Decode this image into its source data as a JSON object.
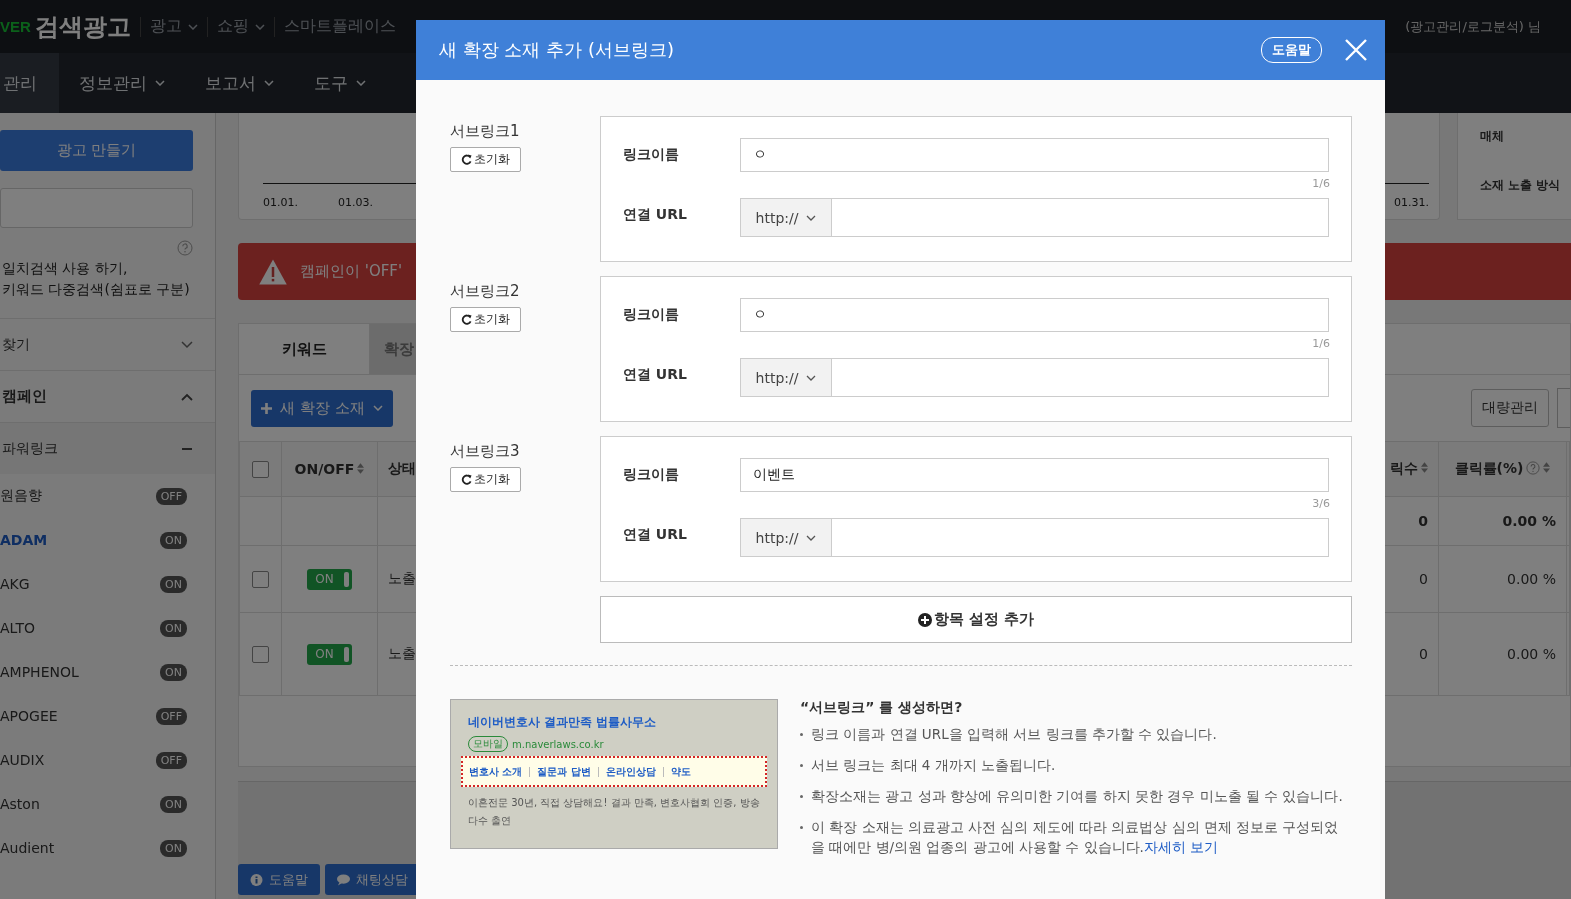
{
  "topbar": {
    "logo_mark": "VER",
    "logo": "검색광고",
    "menus": [
      {
        "label": "광고",
        "dropdown": true
      },
      {
        "label": "쇼핑",
        "dropdown": true
      },
      {
        "label": "스마트플레이스",
        "dropdown": false
      }
    ],
    "account": "(광고관리/로그분석) 님"
  },
  "nav": [
    {
      "label": "관리",
      "selected": true,
      "dropdown": false
    },
    {
      "label": "정보관리",
      "selected": false,
      "dropdown": true
    },
    {
      "label": "보고서",
      "selected": false,
      "dropdown": true
    },
    {
      "label": "도구",
      "selected": false,
      "dropdown": true
    }
  ],
  "sidebar": {
    "create_button": "광고 만들기",
    "search_hint": "일치검색 사용 하기,\n키워드 다중검색(쉼표로 구분)",
    "find": {
      "label": "찾기",
      "expanded": false
    },
    "campaigns": {
      "label": "캠페인",
      "expanded": true
    },
    "group": {
      "label": "파워링크",
      "expanded": true
    },
    "items": [
      {
        "name": "원음향",
        "status": "OFF",
        "selected": false
      },
      {
        "name": "ADAM",
        "status": "ON",
        "selected": true
      },
      {
        "name": "AKG",
        "status": "ON",
        "selected": false
      },
      {
        "name": "ALTO",
        "status": "ON",
        "selected": false
      },
      {
        "name": "AMPHENOL",
        "status": "ON",
        "selected": false
      },
      {
        "name": "APOGEE",
        "status": "OFF",
        "selected": false
      },
      {
        "name": "AUDIX",
        "status": "OFF",
        "selected": false
      },
      {
        "name": "Aston",
        "status": "ON",
        "selected": false
      },
      {
        "name": "Audient",
        "status": "ON",
        "selected": false
      }
    ]
  },
  "main": {
    "chart_ticks": [
      "01.01.",
      "01.03.",
      "01.31."
    ],
    "info_card": [
      "매체",
      "소재 노출 방식"
    ],
    "alert": "캠페인이 'OFF'",
    "tabs": [
      {
        "label": "키워드",
        "selected": true
      },
      {
        "label": "확장",
        "selected": false
      }
    ],
    "new_button": "새 확장 소재",
    "bulk_button": "대량관리",
    "table": {
      "select_all": false,
      "columns": [
        "ON/OFF",
        "상태",
        "릭수",
        "클릭률(%)"
      ],
      "summary": {
        "clicks": "0",
        "ctr": "0.00 %"
      },
      "rows": [
        {
          "checked": false,
          "on": true,
          "toggle": "ON",
          "status": "노출",
          "clicks": "0",
          "ctr": "0.00 %"
        },
        {
          "checked": false,
          "on": true,
          "toggle": "ON",
          "status": "노출",
          "clicks": "0",
          "ctr": "0.00 %"
        }
      ]
    },
    "footer_buttons": [
      {
        "kind": "help",
        "label": "도움말"
      },
      {
        "kind": "chat",
        "label": "채팅상담"
      }
    ]
  },
  "modal": {
    "title": "새 확장 소재 추가 (서브링크)",
    "help_button": "도움말",
    "sublinks": [
      {
        "label": "서브링크1",
        "reset": "초기화",
        "name_label": "링크이름",
        "name_value": "ㅇ",
        "counter": "1/6",
        "url_label": "연결 URL",
        "protocol": "http://"
      },
      {
        "label": "서브링크2",
        "reset": "초기화",
        "name_label": "링크이름",
        "name_value": "ㅇ",
        "counter": "1/6",
        "url_label": "연결 URL",
        "protocol": "http://"
      },
      {
        "label": "서브링크3",
        "reset": "초기화",
        "name_label": "링크이름",
        "name_value": "이벤트",
        "counter": "3/6",
        "url_label": "연결 URL",
        "protocol": "http://"
      }
    ],
    "add_button": "항목 설정 추가",
    "preview": {
      "title": "네이버변호사 결과만족 법률사무소",
      "badge": "모바일",
      "url": "m.naverlaws.co.kr",
      "links": [
        "변호사 소개",
        "질문과 답변",
        "온라인상담",
        "약도"
      ],
      "description": "이혼전문 30년, 직접 상담해요! 결과 만족, 변호사협회 인증, 방송 다수 출연"
    },
    "help": {
      "title": "“서브링크” 를 생성하면?",
      "bullets": [
        {
          "text": "링크 이름과 연결 URL을 입력해 서브 링크를 추가할 수 있습니다."
        },
        {
          "text": "서브 링크는 최대 4 개까지 노출됩니다."
        },
        {
          "text": "확장소재는 광고 성과 향상에 유의미한 기여를 하지 못한 경우 미노출 될 수 있습니다."
        },
        {
          "text": "이 확장 소재는 의료광고 사전 심의 제도에 따라 의료법상 심의 면제 정보로 구성되었을 때에만 병/의원 업종의 광고에 사용할 수 있습니다.",
          "link": "자세히 보기"
        }
      ]
    }
  }
}
